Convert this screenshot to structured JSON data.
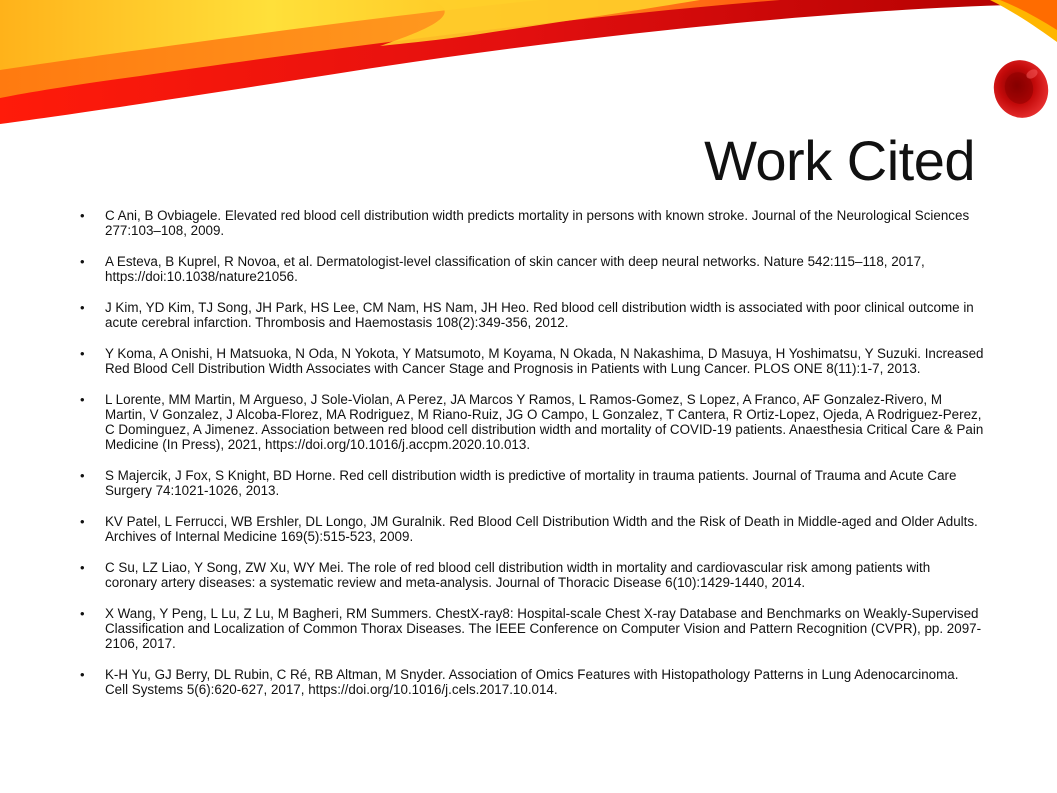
{
  "slide": {
    "title": "Work Cited",
    "bullet_glyph": "•",
    "references": [
      "C Ani, B Ovbiagele. Elevated red blood cell distribution width predicts mortality in persons with known stroke. Journal of the Neurological Sciences 277:103–108, 2009.",
      "A Esteva, B Kuprel, R Novoa, et al. Dermatologist-level classification of skin cancer with deep neural networks. Nature 542:115–118, 2017, https://doi:10.1038/nature21056.",
      "J Kim, YD Kim, TJ Song, JH Park, HS Lee, CM Nam, HS Nam, JH Heo. Red blood cell distribution width is associated with poor clinical outcome in acute cerebral infarction. Thrombosis and Haemostasis 108(2):349-356, 2012.",
      "Y Koma, A Onishi, H Matsuoka, N Oda, N Yokota, Y Matsumoto, M Koyama, N Okada, N Nakashima, D Masuya, H Yoshimatsu, Y Suzuki. Increased Red Blood Cell Distribution Width Associates with Cancer Stage and Prognosis in Patients with Lung Cancer. PLOS ONE 8(11):1-7, 2013.",
      "L Lorente, MM Martin, M Argueso, J Sole-Violan, A Perez, JA Marcos Y Ramos, L Ramos-Gomez, S Lopez, A Franco, AF Gonzalez-Rivero, M Martin, V Gonzalez, J Alcoba-Florez, MA Rodriguez, M Riano-Ruiz, JG O Campo, L Gonzalez, T Cantera, R Ortiz-Lopez, Ojeda, A Rodriguez-Perez, C Dominguez, A Jimenez. Association between red blood cell distribution width and mortality of COVID-19 patients. Anaesthesia Critical Care & Pain Medicine (In Press), 2021, https://doi.org/10.1016/j.accpm.2020.10.013.",
      "S Majercik, J Fox, S Knight, BD Horne. Red cell distribution width is predictive of mortality in trauma patients. Journal of Trauma and Acute Care Surgery 74:1021-1026, 2013.",
      "KV Patel, L Ferrucci, WB Ershler, DL Longo, JM Guralnik. Red Blood Cell Distribution Width and the Risk of Death in Middle-aged and Older Adults. Archives of Internal Medicine 169(5):515-523, 2009.",
      "C Su, LZ Liao, Y Song, ZW Xu, WY Mei. The role of red blood cell distribution width in mortality and cardiovascular risk among patients with coronary artery diseases: a systematic review and meta-analysis. Journal of Thoracic Disease 6(10):1429-1440, 2014.",
      "X Wang, Y Peng, L Lu, Z Lu, M Bagheri, RM Summers. ChestX-ray8: Hospital-scale Chest X-ray Database and Benchmarks on Weakly-Supervised Classification and Localization of Common Thorax Diseases. The IEEE Conference on Computer Vision and Pattern Recognition (CVPR), pp. 2097-2106, 2017.",
      "K-H Yu, GJ Berry, DL Rubin, C Ré, RB Altman, M Snyder. Association of Omics Features with Histopathology Patterns in Lung Adenocarcinoma. Cell Systems 5(6):620-627, 2017, https://doi.org/10.1016/j.cels.2017.10.014."
    ]
  },
  "colors": {
    "red": "#d10f0f",
    "orange": "#f6821f",
    "yellow": "#ffd21f",
    "dark_red": "#8a0000"
  },
  "decor": {
    "swoosh": "red-orange-yellow-swoosh",
    "cell": "red-blood-cell-icon"
  }
}
